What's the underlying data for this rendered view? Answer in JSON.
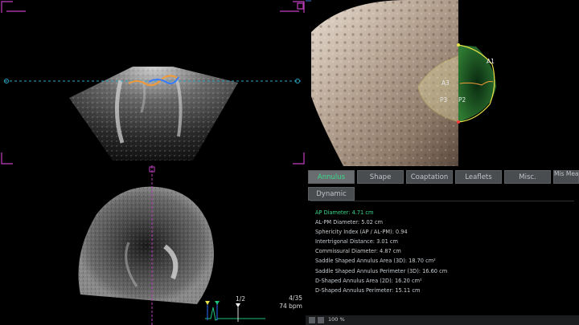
{
  "views": {
    "model_labels": [
      "A3",
      "P3",
      "P2",
      "A1"
    ],
    "frame_counter": "4/35",
    "heart_rate": "74 bpm",
    "phase": "1/2"
  },
  "tabs": [
    {
      "label": "Annulus",
      "active": true
    },
    {
      "label": "Shape",
      "active": false
    },
    {
      "label": "Coaptation",
      "active": false
    },
    {
      "label": "Leaflets",
      "active": false
    },
    {
      "label": "Misc.",
      "active": false
    },
    {
      "label": "Mis Measure",
      "active": false
    },
    {
      "label": "Dynamic",
      "active": false
    }
  ],
  "measurements": [
    "AP Diameter: 4.71 cm",
    "AL-PM Diameter: 5.02 cm",
    "Sphericity Index (AP / AL-PM): 0.94",
    "Intertrigonal Distance: 3.01 cm",
    "Commissural Diameter: 4.87 cm",
    "Saddle Shaped Annulus Area (3D): 18.70 cm²",
    "Saddle Shaped Annulus Perimeter (3D): 16.60 cm",
    "D-Shaped Annulus Area (2D): 16.20 cm²",
    "D-Shaped Annulus Perimeter: 15.11 cm"
  ],
  "statusbar": {
    "zoom": "100 %"
  },
  "colors": {
    "active_text": "#39d98a",
    "crosshair": "#c040c0",
    "guide": "#2aa6c8",
    "annulus": "#e8e04a"
  }
}
